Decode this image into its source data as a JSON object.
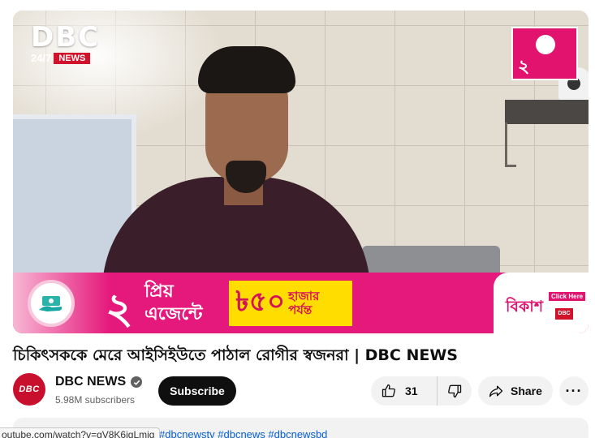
{
  "video": {
    "channel_logo_main": "DBC",
    "channel_logo_tag": "24/7",
    "channel_logo_news": "NEWS",
    "banner": {
      "number": "২",
      "agent_text_1": "প্রিয়",
      "agent_text_2": "এজেন্টে",
      "amount": "৳৫০",
      "amount_unit": "হাজার",
      "upto": "পর্যন্ত",
      "brand": "বিকাশ",
      "click_here": "Click Here",
      "mini_logo": "DBC"
    },
    "corner_ad_number": "২"
  },
  "title": "চিকিৎসককে মেরে আইসিইউতে পাঠাল রোগীর স্বজনরা | DBC NEWS",
  "channel": {
    "avatar_text": "DBC",
    "name": "DBC NEWS",
    "subscribers": "5.98M subscribers",
    "verified_icon": "check-circle-icon"
  },
  "actions": {
    "subscribe": "Subscribe",
    "like_count": "31",
    "share": "Share",
    "more": "···"
  },
  "description": {
    "hashtags": "#dbcnewstv #dbcnews #dbcnewsbd"
  },
  "status_link": "outube.com/watch?v=gV8K6jgLmjg"
}
